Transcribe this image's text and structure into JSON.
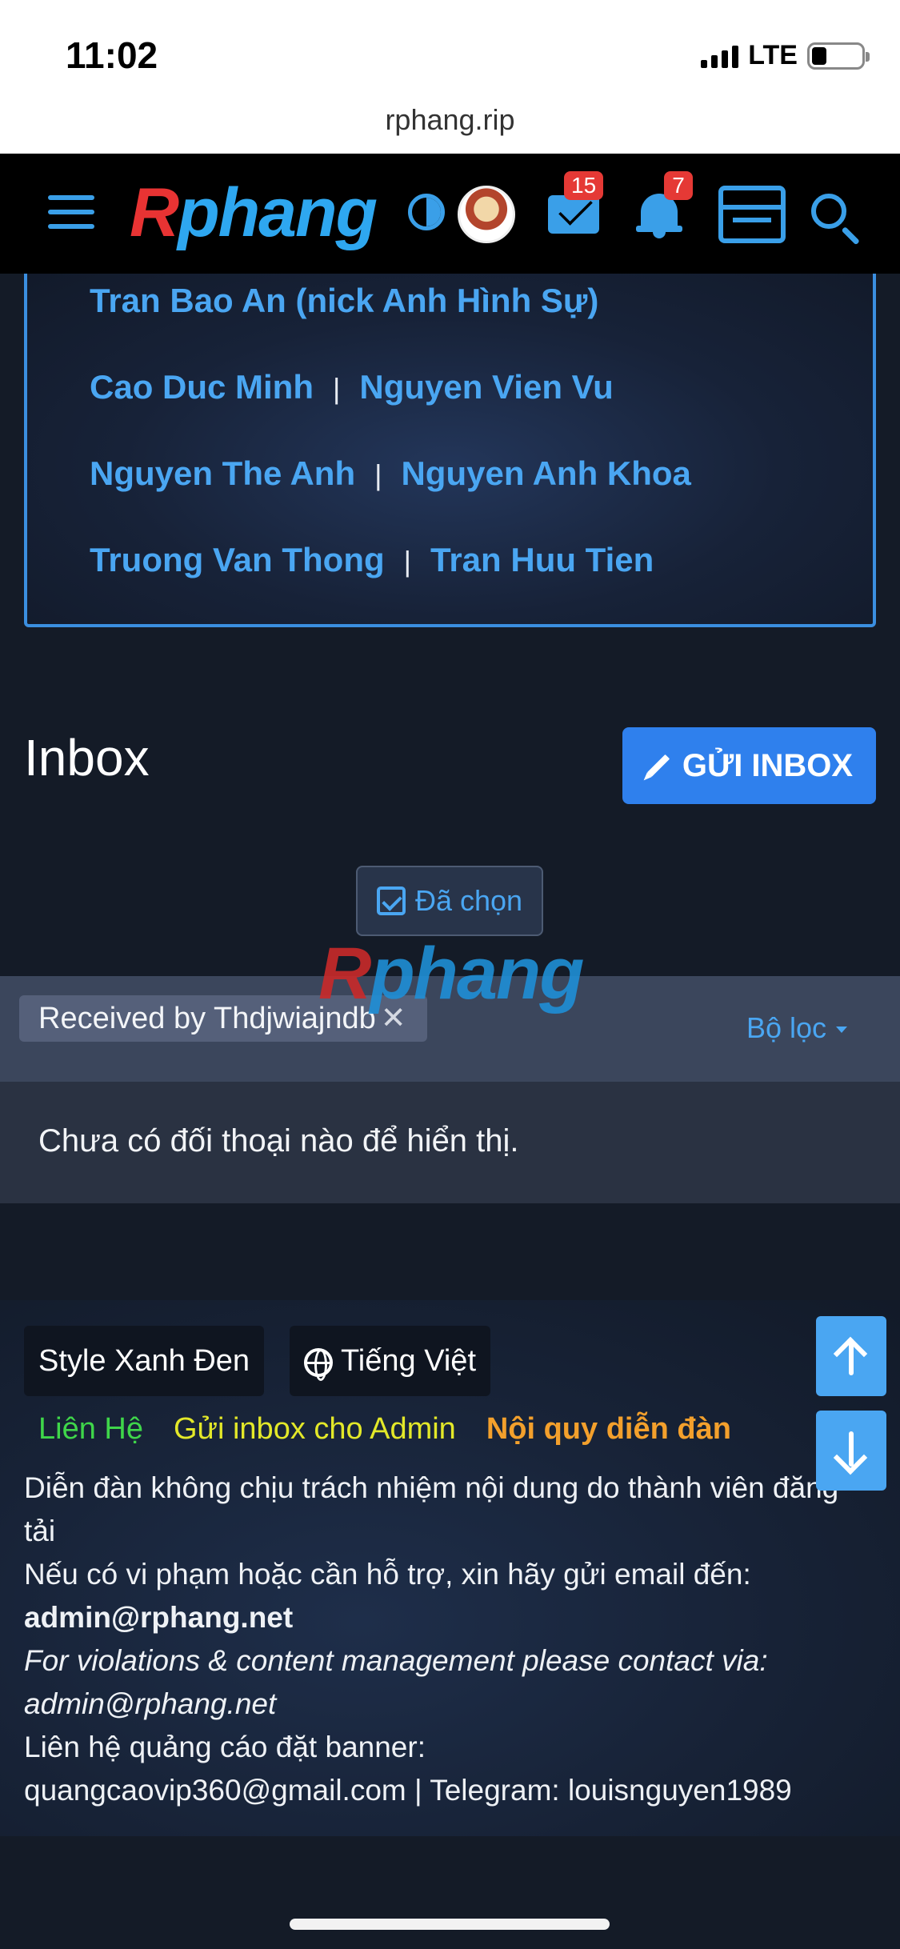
{
  "status_bar": {
    "time": "11:02",
    "network": "LTE",
    "battery_level": 0.3
  },
  "browser": {
    "url": "rphang.rip"
  },
  "header": {
    "logo_first": "R",
    "logo_rest": "phang",
    "mail_badge": "15",
    "notification_badge": "7",
    "accent_color": "#3a9fe8"
  },
  "names": {
    "row1": [
      "Tran Bao An (nick Anh Hình Sự)"
    ],
    "row2": [
      "Cao Duc Minh",
      "Nguyen Vien Vu"
    ],
    "row3": [
      "Nguyen The Anh",
      "Nguyen Anh Khoa"
    ],
    "row4": [
      "Truong Van Thong",
      "Tran Huu Tien"
    ],
    "separator": "|"
  },
  "inbox": {
    "title": "Inbox",
    "send_button": "GỬI INBOX",
    "selected_button": "Đã chọn",
    "filter_chip": "Received by Thdjwiajndb",
    "filter_chip_close": "✕",
    "filter_dropdown": "Bộ lọc",
    "watermark_first": "R",
    "watermark_rest": "phang",
    "empty_message": "Chưa có đối thoại nào để hiển thị."
  },
  "footer": {
    "style_button": "Style Xanh Đen",
    "language_button": "Tiếng Việt",
    "links": {
      "contact": "Liên Hệ",
      "admin_inbox": "Gửi inbox cho Admin",
      "rules": "Nội quy diễn đàn"
    },
    "disclaimer": "Diễn đàn không chịu trách nhiệm nội dung do thành viên đăng tải",
    "support_text": "Nếu có vi phạm hoặc cần hỗ trợ, xin hãy gửi email đến:",
    "support_email": "admin@rphang.net",
    "violations_text": "For violations & content management please contact via:",
    "violations_email": "admin@rphang.net",
    "ads_text": "Liên hệ quảng cáo đặt banner:",
    "ads_contact": "quangcaovip360@gmail.com | Telegram: louisnguyen1989"
  }
}
